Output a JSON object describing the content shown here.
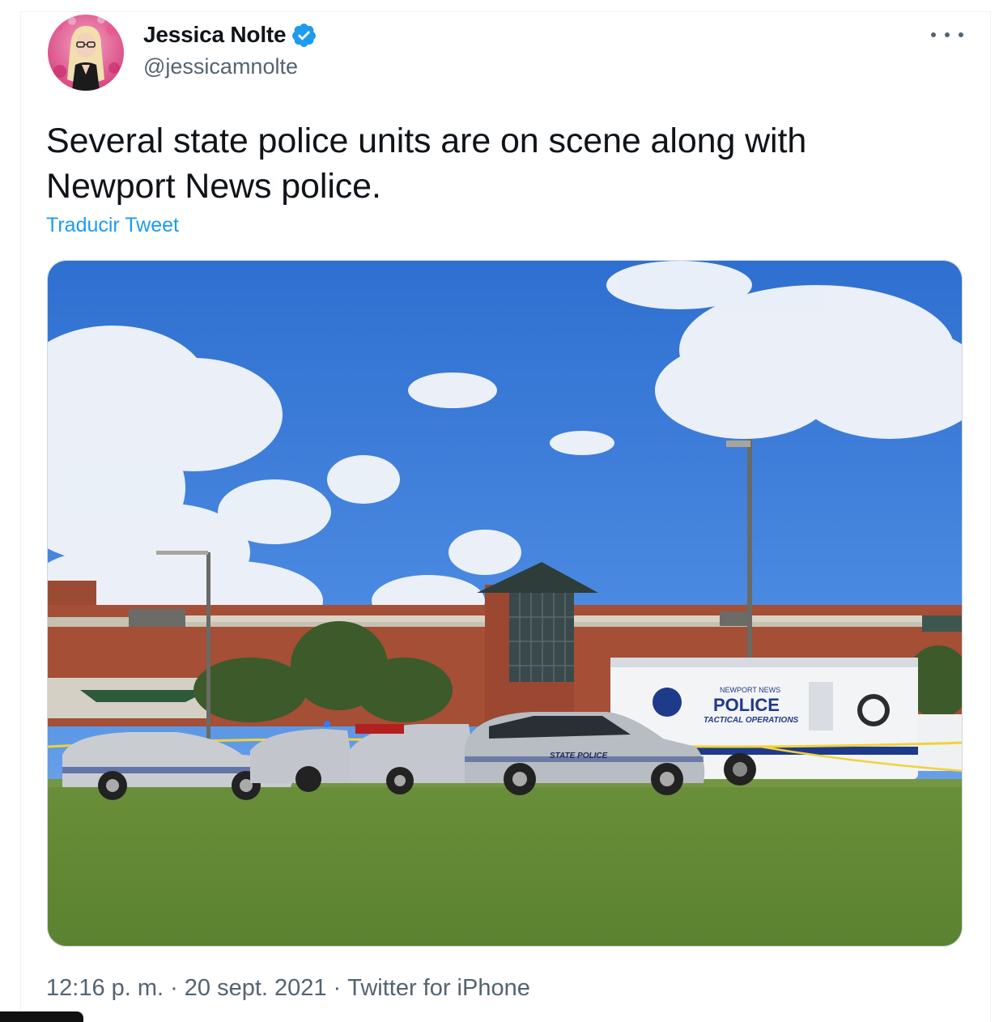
{
  "author": {
    "display_name": "Jessica Nolte",
    "handle": "@jessicamnolte",
    "verified_icon": "verified-badge-icon",
    "avatar_icon": "avatar-photo"
  },
  "menu": {
    "more_icon": "more-dots-icon"
  },
  "tweet": {
    "text": "Several state police units are on scene along with Newport News police.",
    "translate_label": "Traducir Tweet"
  },
  "media": {
    "police_label": "POLICE",
    "tactical_label": "TACTICAL OPERATIONS",
    "newport_label": "NEWPORT NEWS",
    "state_police_label": "STATE POLICE"
  },
  "meta": {
    "time": "12:16 p. m.",
    "separator": "·",
    "date": "20 sept. 2021",
    "source": "Twitter for iPhone"
  },
  "colors": {
    "link": "#1d9bf0",
    "text_primary": "#0f1419",
    "text_secondary": "#536471"
  }
}
